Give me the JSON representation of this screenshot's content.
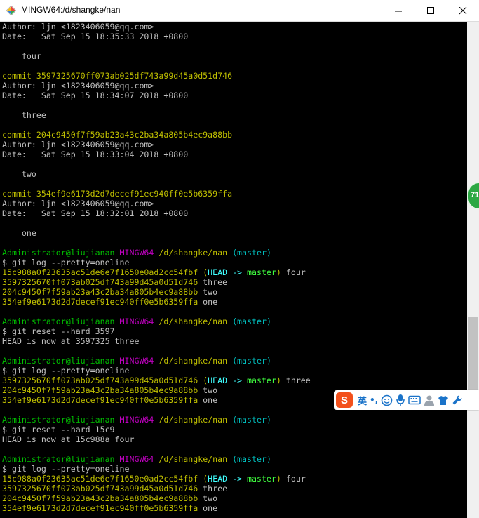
{
  "window": {
    "title": "MINGW64:/d/shangke/nan"
  },
  "colors": {
    "yellow": "#bfbf00",
    "green": "#00bf00",
    "magenta": "#bf00bf",
    "cyan": "#00bfbf",
    "default": "#c0c0c0",
    "head": "#40ffff",
    "branch": "#40ff40"
  },
  "terminal": {
    "lines": [
      [
        {
          "t": "Author: ljn <1823406059@qq.com>",
          "c": "white"
        }
      ],
      [
        {
          "t": "Date:   Sat Sep 15 18:35:33 2018 +0800",
          "c": "white"
        }
      ],
      [],
      [
        {
          "t": "    four",
          "c": "white"
        }
      ],
      [],
      [
        {
          "t": "commit 3597325670ff073ab025df743a99d45a0d51d746",
          "c": "yellow"
        }
      ],
      [
        {
          "t": "Author: ljn <1823406059@qq.com>",
          "c": "white"
        }
      ],
      [
        {
          "t": "Date:   Sat Sep 15 18:34:07 2018 +0800",
          "c": "white"
        }
      ],
      [],
      [
        {
          "t": "    three",
          "c": "white"
        }
      ],
      [],
      [
        {
          "t": "commit 204c9450f7f59ab23a43c2ba34a805b4ec9a88bb",
          "c": "yellow"
        }
      ],
      [
        {
          "t": "Author: ljn <1823406059@qq.com>",
          "c": "white"
        }
      ],
      [
        {
          "t": "Date:   Sat Sep 15 18:33:04 2018 +0800",
          "c": "white"
        }
      ],
      [],
      [
        {
          "t": "    two",
          "c": "white"
        }
      ],
      [],
      [
        {
          "t": "commit 354ef9e6173d2d7decef91ec940ff0e5b6359ffa",
          "c": "yellow"
        }
      ],
      [
        {
          "t": "Author: ljn <1823406059@qq.com>",
          "c": "white"
        }
      ],
      [
        {
          "t": "Date:   Sat Sep 15 18:32:01 2018 +0800",
          "c": "white"
        }
      ],
      [],
      [
        {
          "t": "    one",
          "c": "white"
        }
      ],
      [],
      [
        {
          "t": "Administrator@liujianan ",
          "c": "green"
        },
        {
          "t": "MINGW64 ",
          "c": "magenta"
        },
        {
          "t": "/d/shangke/nan ",
          "c": "yellow"
        },
        {
          "t": "(master)",
          "c": "cyan"
        }
      ],
      [
        {
          "t": "$ git log --pretty=oneline",
          "c": "white"
        }
      ],
      [
        {
          "t": "15c988a0f23635ac51de6e7f1650e0ad2cc54fbf ",
          "c": "yellow"
        },
        {
          "t": "(",
          "c": "yellow"
        },
        {
          "t": "HEAD -> ",
          "c": "bcyan"
        },
        {
          "t": "master",
          "c": "bgreen"
        },
        {
          "t": ")",
          "c": "yellow"
        },
        {
          "t": " four",
          "c": "white"
        }
      ],
      [
        {
          "t": "3597325670ff073ab025df743a99d45a0d51d746",
          "c": "yellow"
        },
        {
          "t": " three",
          "c": "white"
        }
      ],
      [
        {
          "t": "204c9450f7f59ab23a43c2ba34a805b4ec9a88bb",
          "c": "yellow"
        },
        {
          "t": " two",
          "c": "white"
        }
      ],
      [
        {
          "t": "354ef9e6173d2d7decef91ec940ff0e5b6359ffa",
          "c": "yellow"
        },
        {
          "t": " one",
          "c": "white"
        }
      ],
      [],
      [
        {
          "t": "Administrator@liujianan ",
          "c": "green"
        },
        {
          "t": "MINGW64 ",
          "c": "magenta"
        },
        {
          "t": "/d/shangke/nan ",
          "c": "yellow"
        },
        {
          "t": "(master)",
          "c": "cyan"
        }
      ],
      [
        {
          "t": "$ git reset --hard 3597",
          "c": "white"
        }
      ],
      [
        {
          "t": "HEAD is now at 3597325 three",
          "c": "white"
        }
      ],
      [],
      [
        {
          "t": "Administrator@liujianan ",
          "c": "green"
        },
        {
          "t": "MINGW64 ",
          "c": "magenta"
        },
        {
          "t": "/d/shangke/nan ",
          "c": "yellow"
        },
        {
          "t": "(master)",
          "c": "cyan"
        }
      ],
      [
        {
          "t": "$ git log --pretty=oneline",
          "c": "white"
        }
      ],
      [
        {
          "t": "3597325670ff073ab025df743a99d45a0d51d746 ",
          "c": "yellow"
        },
        {
          "t": "(",
          "c": "yellow"
        },
        {
          "t": "HEAD -> ",
          "c": "bcyan"
        },
        {
          "t": "master",
          "c": "bgreen"
        },
        {
          "t": ")",
          "c": "yellow"
        },
        {
          "t": " three",
          "c": "white"
        }
      ],
      [
        {
          "t": "204c9450f7f59ab23a43c2ba34a805b4ec9a88bb",
          "c": "yellow"
        },
        {
          "t": " two",
          "c": "white"
        }
      ],
      [
        {
          "t": "354ef9e6173d2d7decef91ec940ff0e5b6359ffa",
          "c": "yellow"
        },
        {
          "t": " one",
          "c": "white"
        }
      ],
      [],
      [
        {
          "t": "Administrator@liujianan ",
          "c": "green"
        },
        {
          "t": "MINGW64 ",
          "c": "magenta"
        },
        {
          "t": "/d/shangke/nan ",
          "c": "yellow"
        },
        {
          "t": "(master)",
          "c": "cyan"
        }
      ],
      [
        {
          "t": "$ git reset --hard 15c9",
          "c": "white"
        }
      ],
      [
        {
          "t": "HEAD is now at 15c988a four",
          "c": "white"
        }
      ],
      [],
      [
        {
          "t": "Administrator@liujianan ",
          "c": "green"
        },
        {
          "t": "MINGW64 ",
          "c": "magenta"
        },
        {
          "t": "/d/shangke/nan ",
          "c": "yellow"
        },
        {
          "t": "(master)",
          "c": "cyan"
        }
      ],
      [
        {
          "t": "$ git log --pretty=oneline",
          "c": "white"
        }
      ],
      [
        {
          "t": "15c988a0f23635ac51de6e7f1650e0ad2cc54fbf ",
          "c": "yellow"
        },
        {
          "t": "(",
          "c": "yellow"
        },
        {
          "t": "HEAD -> ",
          "c": "bcyan"
        },
        {
          "t": "master",
          "c": "bgreen"
        },
        {
          "t": ")",
          "c": "yellow"
        },
        {
          "t": " four",
          "c": "white"
        }
      ],
      [
        {
          "t": "3597325670ff073ab025df743a99d45a0d51d746",
          "c": "yellow"
        },
        {
          "t": " three",
          "c": "white"
        }
      ],
      [
        {
          "t": "204c9450f7f59ab23a43c2ba34a805b4ec9a88bb",
          "c": "yellow"
        },
        {
          "t": " two",
          "c": "white"
        }
      ],
      [
        {
          "t": "354ef9e6173d2d7decef91ec940ff0e5b6359ffa",
          "c": "yellow"
        },
        {
          "t": " one",
          "c": "white"
        }
      ]
    ]
  },
  "side_bubble": {
    "text": "71"
  },
  "ime_toolbar": {
    "logo_text": "S",
    "mode_label": "英",
    "punct_label": "•,",
    "icons": [
      "emoji-icon",
      "microphone-icon",
      "keyboard-icon",
      "user-icon",
      "skin-icon",
      "settings-icon"
    ]
  }
}
